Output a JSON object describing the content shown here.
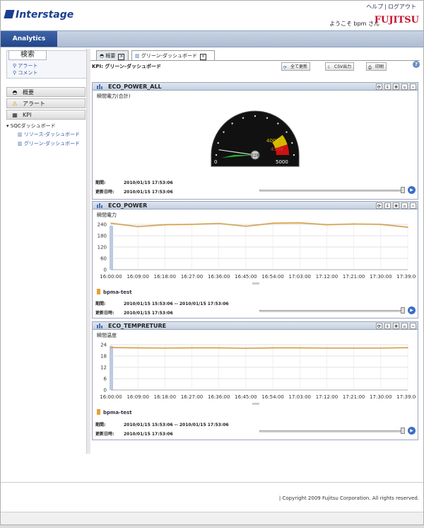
{
  "header": {
    "logo": "Interstage",
    "links": [
      "ヘルプ",
      "ログアウト"
    ],
    "welcome": "ようこそ bpm さん",
    "brand": "FUJITSU"
  },
  "nav": {
    "tab": "Analytics"
  },
  "sidebar": {
    "search": {
      "title": "検索",
      "links": [
        "アラート",
        "コメント"
      ]
    },
    "sections": [
      "概要",
      "アラート",
      "KPI"
    ],
    "tree": {
      "root": "SQCダッシュボード",
      "children": [
        "リソース-ダッシュボード",
        "グリーン-ダッシュボード"
      ]
    }
  },
  "main": {
    "tabs": [
      "概要",
      "グリーン-ダッシュボード"
    ],
    "kpi_title": "KPI: グリーン-ダッシュボード",
    "toolbar": {
      "update_all": "全て更新",
      "csv": "CSV出力",
      "print": "印刷"
    }
  },
  "panels": [
    {
      "title": "ECO_POWER_ALL",
      "subtitle": "瞬間電力(合計)",
      "period_label": "期間:",
      "period_value": "2010/01/15 17:53:06",
      "updated_label": "更新日時:",
      "updated_value": "2010/01/15 17:53:06"
    },
    {
      "title": "ECO_POWER",
      "subtitle": "瞬間電力",
      "legend": "bpma-test",
      "period_label": "期間:",
      "period_value": "2010/01/15 15:53:06 -- 2010/01/15 17:53:06",
      "updated_label": "更新日時:",
      "updated_value": "2010/01/15 17:53:06"
    },
    {
      "title": "ECO_TEMPRETURE",
      "subtitle": "瞬間温度",
      "legend": "bpma-test",
      "period_label": "期間:",
      "period_value": "2010/01/15 15:53:06 -- 2010/01/15 17:53:06",
      "updated_label": "更新日時:",
      "updated_value": "2010/01/15 17:53:06"
    }
  ],
  "footer": {
    "copyright": "| Copyright 2009 Fujitsu Corporation. All rights reserved."
  },
  "colors": {
    "accent": "#2a4f94",
    "series": "#e8a030",
    "gauge_green": "#22cc33",
    "gauge_yellow": "#d4b800",
    "gauge_red": "#cc1111"
  },
  "chart_data": [
    {
      "type": "gauge",
      "min": 0,
      "max": 5000,
      "value": 228,
      "value_label": "228",
      "bands": [
        {
          "from": 0,
          "to": 4000,
          "color": "#22cc33"
        },
        {
          "from": 4000,
          "to": 4500,
          "color": "#d4b800"
        },
        {
          "from": 4500,
          "to": 5000,
          "color": "#cc1111"
        }
      ],
      "labels": [
        "0",
        "4000",
        "4500",
        "5000"
      ]
    },
    {
      "type": "line",
      "x": [
        "16:00:00",
        "16:09:00",
        "16:18:00",
        "16:27:00",
        "16:36:00",
        "16:45:00",
        "16:54:00",
        "17:03:00",
        "17:12:00",
        "17:21:00",
        "17:30:00",
        "17:39:00"
      ],
      "yticks": [
        "0",
        "60",
        "120",
        "180",
        "240"
      ],
      "ylim": [
        0,
        240
      ],
      "series": [
        {
          "name": "bpma-test",
          "values": [
            246,
            228,
            238,
            240,
            245,
            230,
            246,
            248,
            238,
            242,
            240,
            225
          ]
        }
      ]
    },
    {
      "type": "line",
      "x": [
        "16:00:00",
        "16:09:00",
        "16:18:00",
        "16:27:00",
        "16:36:00",
        "16:45:00",
        "16:54:00",
        "17:03:00",
        "17:12:00",
        "17:21:00",
        "17:30:00",
        "17:39:00"
      ],
      "yticks": [
        "0",
        "6",
        "12",
        "18",
        "24"
      ],
      "ylim": [
        0,
        24
      ],
      "series": [
        {
          "name": "bpma-test",
          "values": [
            22.5,
            22.3,
            22.2,
            22.3,
            22.3,
            22.1,
            22.3,
            22.3,
            22.2,
            22.2,
            22.2,
            22.4
          ]
        }
      ]
    }
  ]
}
